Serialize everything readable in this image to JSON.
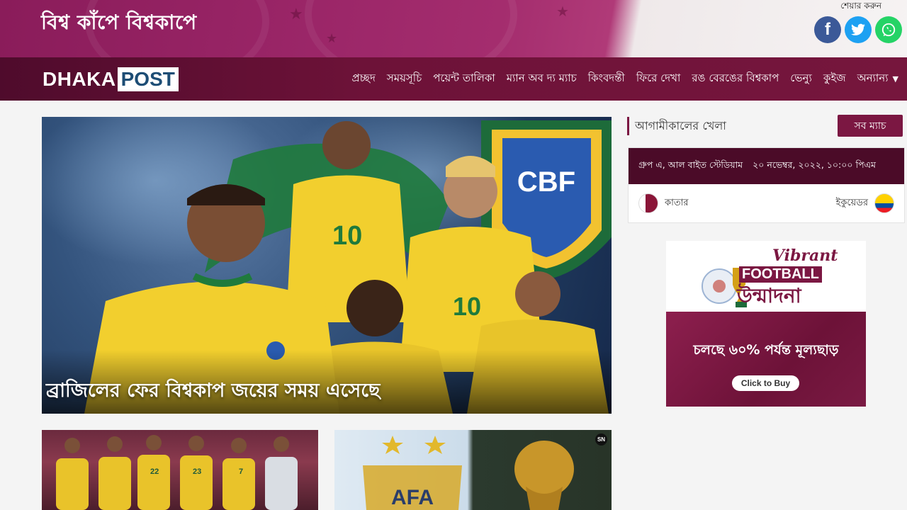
{
  "banner": {
    "tagline": "বিশ্ব কাঁপে বিশ্বকাপে",
    "share_label": "শেয়ার করুন",
    "share": [
      {
        "name": "facebook",
        "glyph": "f",
        "color": "#3b5998"
      },
      {
        "name": "twitter",
        "color": "#1da1f2"
      },
      {
        "name": "whatsapp",
        "color": "#25d366"
      }
    ]
  },
  "logo": {
    "part1": "DHAKA",
    "part2": "POST"
  },
  "nav": {
    "items": [
      "প্রচ্ছদ",
      "সময়সূচি",
      "পয়েন্ট তালিকা",
      "ম্যান অব দ্য ম্যাচ",
      "কিংবদন্তী",
      "ফিরে দেখা",
      "রঙ বেরঙের বিশ্বকাপ",
      "ভেন্যু",
      "কুইজ",
      "অন্যান্য"
    ],
    "more_icon": "caret-down-icon"
  },
  "hero": {
    "title": "ব্রাজিলের ফের বিশ্বকাপ জয়ের সময় এসেছে",
    "jersey_numbers": [
      "10",
      "10",
      "10"
    ],
    "crest_text": "CBF"
  },
  "widget": {
    "title": "আগামীকালের খেলা",
    "all_matches_label": "সব ম্যাচ",
    "match": {
      "venue": "গ্রুপ এ, আল বাইত স্টেডিয়াম",
      "datetime": "২০ নভেম্বর, ২০২২, ১০:০০ পিএম",
      "team_a": "কাতার",
      "team_b": "ইকুয়েডর"
    }
  },
  "ad": {
    "vibrant": "Vibrant",
    "football": "FOOTBALL",
    "bangla_title": "উন্মাদনা",
    "offer": "চলছে ৬০% পর্যন্ত মূল্যছাড়",
    "cta": "Click to Buy"
  },
  "cards": {
    "card2_badge": "SN",
    "card2_crest": "AFA",
    "team_photo_numbers": [
      "22",
      "23",
      "7"
    ]
  },
  "colors": {
    "brand": "#7b1742",
    "nav_bg": "#6d1238",
    "match_header": "#4b0b28"
  }
}
